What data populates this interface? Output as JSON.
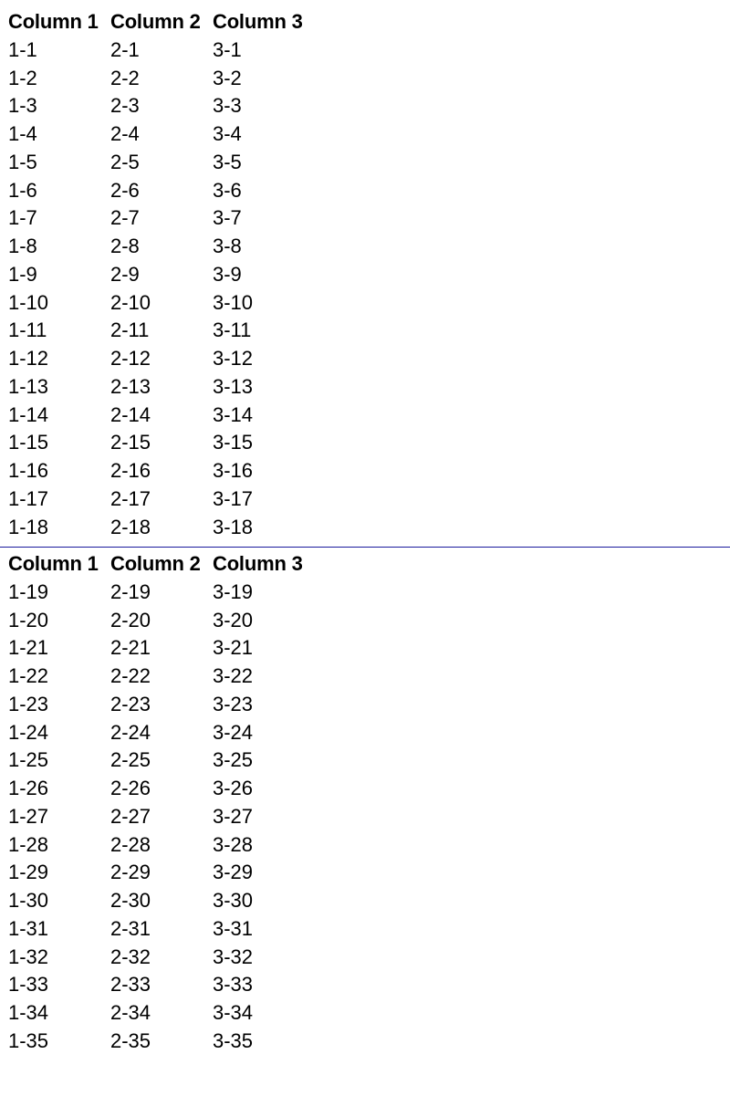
{
  "colors": {
    "page_break_line": "#1a1a9c",
    "text": "#000000",
    "background": "#ffffff"
  },
  "sections": [
    {
      "headers": [
        "Column 1",
        "Column 2",
        "Column 3"
      ],
      "rows": [
        [
          "1-1",
          "2-1",
          "3-1"
        ],
        [
          "1-2",
          "2-2",
          "3-2"
        ],
        [
          "1-3",
          "2-3",
          "3-3"
        ],
        [
          "1-4",
          "2-4",
          "3-4"
        ],
        [
          "1-5",
          "2-5",
          "3-5"
        ],
        [
          "1-6",
          "2-6",
          "3-6"
        ],
        [
          "1-7",
          "2-7",
          "3-7"
        ],
        [
          "1-8",
          "2-8",
          "3-8"
        ],
        [
          "1-9",
          "2-9",
          "3-9"
        ],
        [
          "1-10",
          "2-10",
          "3-10"
        ],
        [
          "1-11",
          "2-11",
          "3-11"
        ],
        [
          "1-12",
          "2-12",
          "3-12"
        ],
        [
          "1-13",
          "2-13",
          "3-13"
        ],
        [
          "1-14",
          "2-14",
          "3-14"
        ],
        [
          "1-15",
          "2-15",
          "3-15"
        ],
        [
          "1-16",
          "2-16",
          "3-16"
        ],
        [
          "1-17",
          "2-17",
          "3-17"
        ],
        [
          "1-18",
          "2-18",
          "3-18"
        ]
      ]
    },
    {
      "headers": [
        "Column 1",
        "Column 2",
        "Column 3"
      ],
      "rows": [
        [
          "1-19",
          "2-19",
          "3-19"
        ],
        [
          "1-20",
          "2-20",
          "3-20"
        ],
        [
          "1-21",
          "2-21",
          "3-21"
        ],
        [
          "1-22",
          "2-22",
          "3-22"
        ],
        [
          "1-23",
          "2-23",
          "3-23"
        ],
        [
          "1-24",
          "2-24",
          "3-24"
        ],
        [
          "1-25",
          "2-25",
          "3-25"
        ],
        [
          "1-26",
          "2-26",
          "3-26"
        ],
        [
          "1-27",
          "2-27",
          "3-27"
        ],
        [
          "1-28",
          "2-28",
          "3-28"
        ],
        [
          "1-29",
          "2-29",
          "3-29"
        ],
        [
          "1-30",
          "2-30",
          "3-30"
        ],
        [
          "1-31",
          "2-31",
          "3-31"
        ],
        [
          "1-32",
          "2-32",
          "3-32"
        ],
        [
          "1-33",
          "2-33",
          "3-33"
        ],
        [
          "1-34",
          "2-34",
          "3-34"
        ],
        [
          "1-35",
          "2-35",
          "3-35"
        ]
      ]
    }
  ]
}
